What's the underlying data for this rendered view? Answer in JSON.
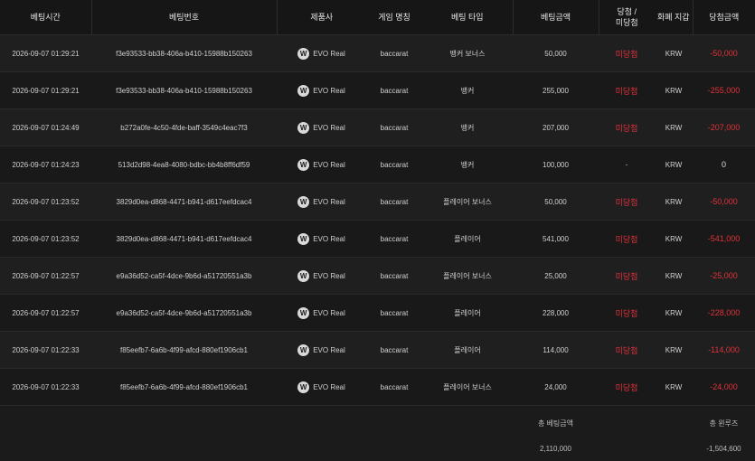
{
  "headers": {
    "time": "베팅시간",
    "bet_id": "베팅번호",
    "provider": "제품사",
    "game_name": "게임 명칭",
    "bet_type": "베팅 타입",
    "bet_amount": "베팅금액",
    "status_line1": "당첨 /",
    "status_line2": "미당첨",
    "currency": "화폐 지갑",
    "win_amount": "당첨금액"
  },
  "rows": [
    {
      "time": "2026-09-07 01:29:21",
      "bet_id": "f3e93533-bb38-406a-b410-15988b150263",
      "provider": "EVO Real",
      "game": "baccarat",
      "type": "뱅커 보너스",
      "amount": "50,000",
      "status": "미당첨",
      "currency": "KRW",
      "win": "-50,000"
    },
    {
      "time": "2026-09-07 01:29:21",
      "bet_id": "f3e93533-bb38-406a-b410-15988b150263",
      "provider": "EVO Real",
      "game": "baccarat",
      "type": "뱅커",
      "amount": "255,000",
      "status": "미당첨",
      "currency": "KRW",
      "win": "-255,000"
    },
    {
      "time": "2026-09-07 01:24:49",
      "bet_id": "b272a0fe-4c50-4fde-baff-3549c4eac7f3",
      "provider": "EVO Real",
      "game": "baccarat",
      "type": "뱅커",
      "amount": "207,000",
      "status": "미당첨",
      "currency": "KRW",
      "win": "-207,000"
    },
    {
      "time": "2026-09-07 01:24:23",
      "bet_id": "513d2d98-4ea8-4080-bdbc-bb4b8ff6df59",
      "provider": "EVO Real",
      "game": "baccarat",
      "type": "뱅커",
      "amount": "100,000",
      "status": "-",
      "currency": "KRW",
      "win": "0"
    },
    {
      "time": "2026-09-07 01:23:52",
      "bet_id": "3829d0ea-d868-4471-b941-d617eefdcac4",
      "provider": "EVO Real",
      "game": "baccarat",
      "type": "플레이어 보너스",
      "amount": "50,000",
      "status": "미당첨",
      "currency": "KRW",
      "win": "-50,000"
    },
    {
      "time": "2026-09-07 01:23:52",
      "bet_id": "3829d0ea-d868-4471-b941-d617eefdcac4",
      "provider": "EVO Real",
      "game": "baccarat",
      "type": "플레이어",
      "amount": "541,000",
      "status": "미당첨",
      "currency": "KRW",
      "win": "-541,000"
    },
    {
      "time": "2026-09-07 01:22:57",
      "bet_id": "e9a36d52-ca5f-4dce-9b6d-a51720551a3b",
      "provider": "EVO Real",
      "game": "baccarat",
      "type": "플레이어 보너스",
      "amount": "25,000",
      "status": "미당첨",
      "currency": "KRW",
      "win": "-25,000"
    },
    {
      "time": "2026-09-07 01:22:57",
      "bet_id": "e9a36d52-ca5f-4dce-9b6d-a51720551a3b",
      "provider": "EVO Real",
      "game": "baccarat",
      "type": "플레이어",
      "amount": "228,000",
      "status": "미당첨",
      "currency": "KRW",
      "win": "-228,000"
    },
    {
      "time": "2026-09-07 01:22:33",
      "bet_id": "f85eefb7-6a6b-4f99-afcd-880ef1906cb1",
      "provider": "EVO Real",
      "game": "baccarat",
      "type": "플레이어",
      "amount": "114,000",
      "status": "미당첨",
      "currency": "KRW",
      "win": "-114,000"
    },
    {
      "time": "2026-09-07 01:22:33",
      "bet_id": "f85eefb7-6a6b-4f99-afcd-880ef1906cb1",
      "provider": "EVO Real",
      "game": "baccarat",
      "type": "플레이어 보너스",
      "amount": "24,000",
      "status": "미당첨",
      "currency": "KRW",
      "win": "-24,000"
    }
  ],
  "footer": {
    "total_bet_label": "총 베팅금액",
    "total_bet_value": "2,110,000",
    "total_win_label": "총 윈루즈",
    "total_win_value": "-1,504,600"
  },
  "provider_icon": "evo-logo-icon",
  "colors": {
    "loss": "#e0323a",
    "background": "#1b1b1b"
  }
}
